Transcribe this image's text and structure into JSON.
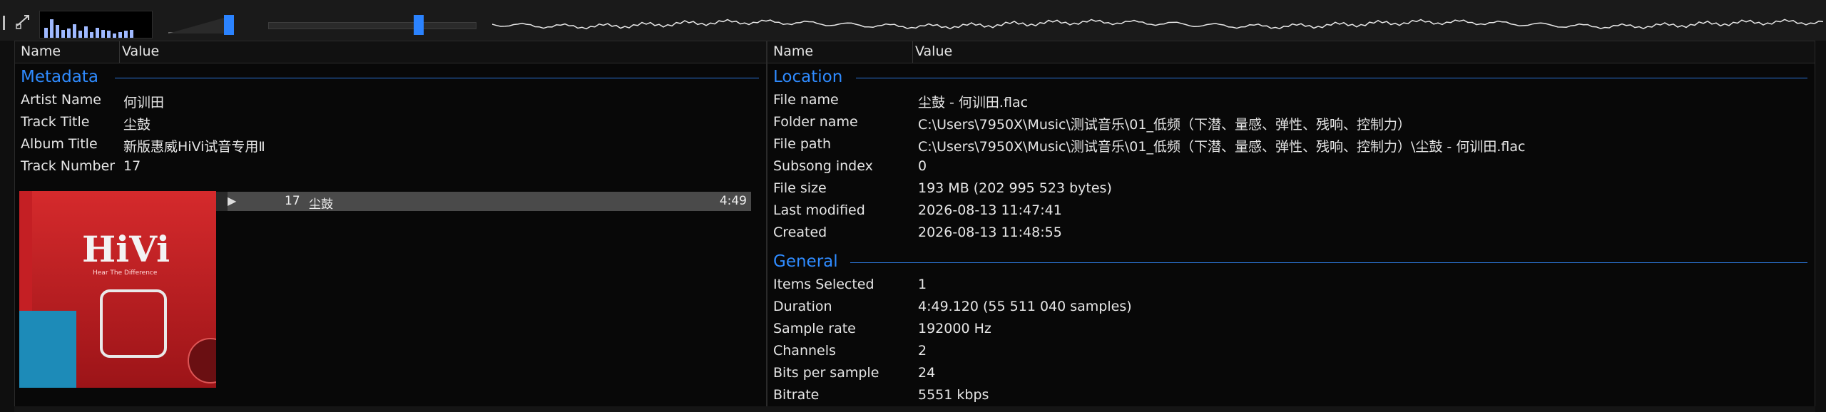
{
  "toolbar": {
    "spectrum_levels": [
      0.45,
      0.8,
      0.55,
      0.35,
      0.4,
      0.6,
      0.3,
      0.5,
      0.25,
      0.45,
      0.35,
      0.3,
      0.2,
      0.25,
      0.3,
      0.35
    ],
    "volume_level": 0.92,
    "seek_position": 0.72,
    "accent": "#2b83ff"
  },
  "left_panel": {
    "col_name": "Name",
    "col_value": "Value",
    "section_title": "Metadata",
    "rows": [
      {
        "k": "Artist Name",
        "v": "何训田"
      },
      {
        "k": "Track Title",
        "v": "尘鼓"
      },
      {
        "k": "Album Title",
        "v": "新版惠威HiVi试音专用Ⅱ"
      },
      {
        "k": "Track Number",
        "v": "17"
      }
    ],
    "art_logo": "HiVi",
    "art_sub": "Hear The Difference"
  },
  "mini_player": {
    "number": "17",
    "title": "尘鼓",
    "time": "4:49"
  },
  "right_panel": {
    "col_name": "Name",
    "col_value": "Value",
    "location_title": "Location",
    "location_rows": [
      {
        "k": "File name",
        "v": "尘鼓 - 何训田.flac"
      },
      {
        "k": "Folder name",
        "v": "C:\\Users\\7950X\\Music\\测试音乐\\01_低频（下潜、量感、弹性、残响、控制力）"
      },
      {
        "k": "File path",
        "v": "C:\\Users\\7950X\\Music\\测试音乐\\01_低频（下潜、量感、弹性、残响、控制力）\\尘鼓 - 何训田.flac"
      },
      {
        "k": "Subsong index",
        "v": "0"
      },
      {
        "k": "File size",
        "v": "193 MB (202 995 523 bytes)"
      },
      {
        "k": "Last modified",
        "v": "2026-08-13 11:47:41"
      },
      {
        "k": "Created",
        "v": "2026-08-13 11:48:55"
      }
    ],
    "general_title": "General",
    "general_rows": [
      {
        "k": "Items Selected",
        "v": "1"
      },
      {
        "k": "Duration",
        "v": "4:49.120 (55 511 040 samples)"
      },
      {
        "k": "Sample rate",
        "v": "192000 Hz"
      },
      {
        "k": "Channels",
        "v": "2"
      },
      {
        "k": "Bits per sample",
        "v": "24"
      },
      {
        "k": "Bitrate",
        "v": "5551 kbps"
      }
    ]
  }
}
